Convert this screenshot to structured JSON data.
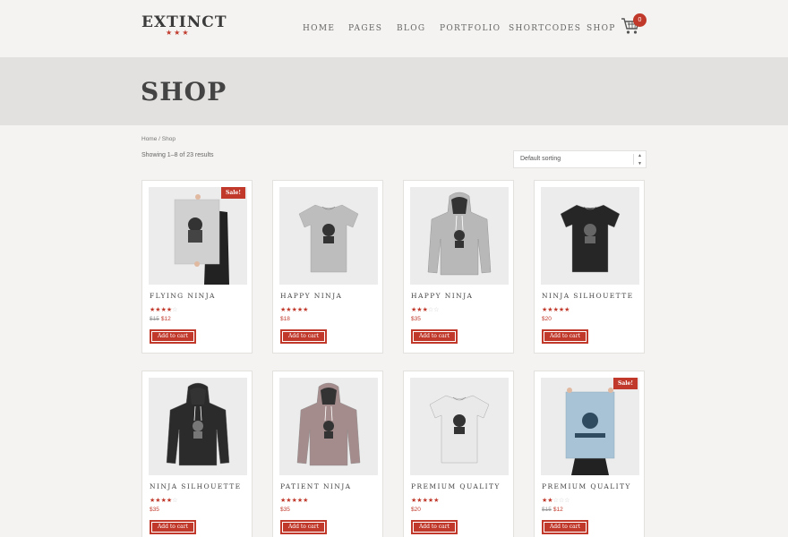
{
  "header": {
    "logo": "EXTINCT",
    "logo_stars": "★★★",
    "nav": [
      "Home",
      "Pages",
      "Blog",
      "Portfolio",
      "Shortcodes",
      "Shop"
    ],
    "cart_count": "0"
  },
  "page_title": "SHOP",
  "breadcrumb": {
    "home": "Home",
    "separator": "/",
    "current": "Shop"
  },
  "result_count": "Showing 1–8 of 23 results",
  "sorting": {
    "selected": "Default sorting"
  },
  "colors": {
    "accent": "#c0392b",
    "background": "#f4f3f1",
    "band": "#e2e1df"
  },
  "products": [
    {
      "name": "Flying Ninja",
      "rating": 4,
      "old_price": "$15",
      "price": "$12",
      "sale": "Sale!",
      "button": "Add to cart",
      "image": "poster"
    },
    {
      "name": "Happy Ninja",
      "rating": 5,
      "old_price": "",
      "price": "$18",
      "sale": "",
      "button": "Add to cart",
      "image": "tshirt-grey"
    },
    {
      "name": "Happy Ninja",
      "rating": 3,
      "old_price": "",
      "price": "$35",
      "sale": "",
      "button": "Add to cart",
      "image": "hoodie-grey"
    },
    {
      "name": "Ninja Silhouette",
      "rating": 5,
      "old_price": "",
      "price": "$20",
      "sale": "",
      "button": "Add to cart",
      "image": "tshirt-black"
    },
    {
      "name": "Ninja Silhouette",
      "rating": 4,
      "old_price": "",
      "price": "$35",
      "sale": "",
      "button": "Add to cart",
      "image": "hoodie-black"
    },
    {
      "name": "Patient Ninja",
      "rating": 5,
      "old_price": "",
      "price": "$35",
      "sale": "",
      "button": "Add to cart",
      "image": "hoodie-pink"
    },
    {
      "name": "Premium Quality",
      "rating": 5,
      "old_price": "",
      "price": "$20",
      "sale": "",
      "button": "Add to cart",
      "image": "tshirt-white"
    },
    {
      "name": "Premium Quality",
      "rating": 2,
      "old_price": "$15",
      "price": "$12",
      "sale": "Sale!",
      "button": "Add to cart",
      "image": "poster-blue"
    }
  ]
}
